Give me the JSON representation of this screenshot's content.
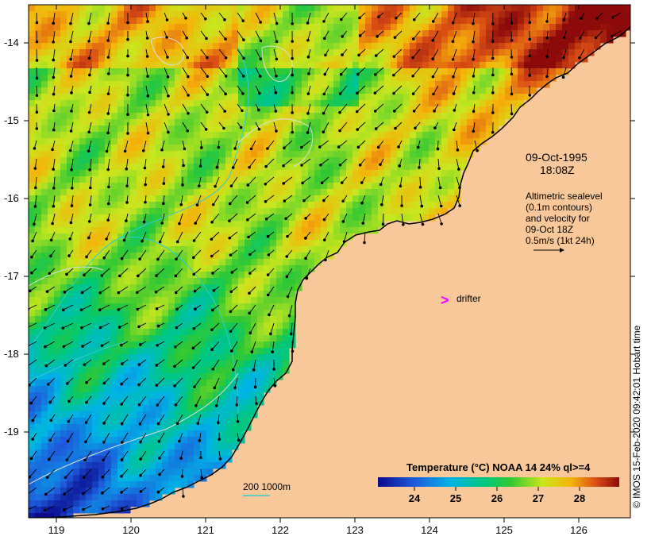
{
  "map": {
    "lon_ticks": [
      "119",
      "120",
      "121",
      "122",
      "123",
      "124",
      "125",
      "126"
    ],
    "lat_ticks": [
      "-14",
      "-15",
      "-16",
      "-17",
      "-18",
      "-19"
    ],
    "lon_range": [
      118.6,
      126.7
    ],
    "lat_range": [
      -20.1,
      -13.5
    ]
  },
  "annotations": {
    "date": "09-Oct-1995",
    "time": "18:08Z",
    "description": [
      "Altimetric sealevel",
      "(0.1m contours)",
      "and velocity for",
      "09-Oct 18Z",
      "0.5m/s (1kt 24h)"
    ],
    "drifter_marker": ">",
    "drifter_label": "drifter"
  },
  "depth_legend": {
    "label": "200  1000m"
  },
  "colorbar": {
    "title": "Temperature (°C) NOAA 14 24% ql>=4",
    "ticks": [
      "24",
      "25",
      "26",
      "27",
      "28"
    ],
    "range": [
      23.4,
      28.6
    ]
  },
  "copyright": "© IMOS 15-Feb-2020 09:42:01 Hobart time",
  "colors": {
    "land": "#f8c89a",
    "drifter": "#ff00ff",
    "contour": "#dddddd",
    "bathymetry": "#33cccc"
  }
}
